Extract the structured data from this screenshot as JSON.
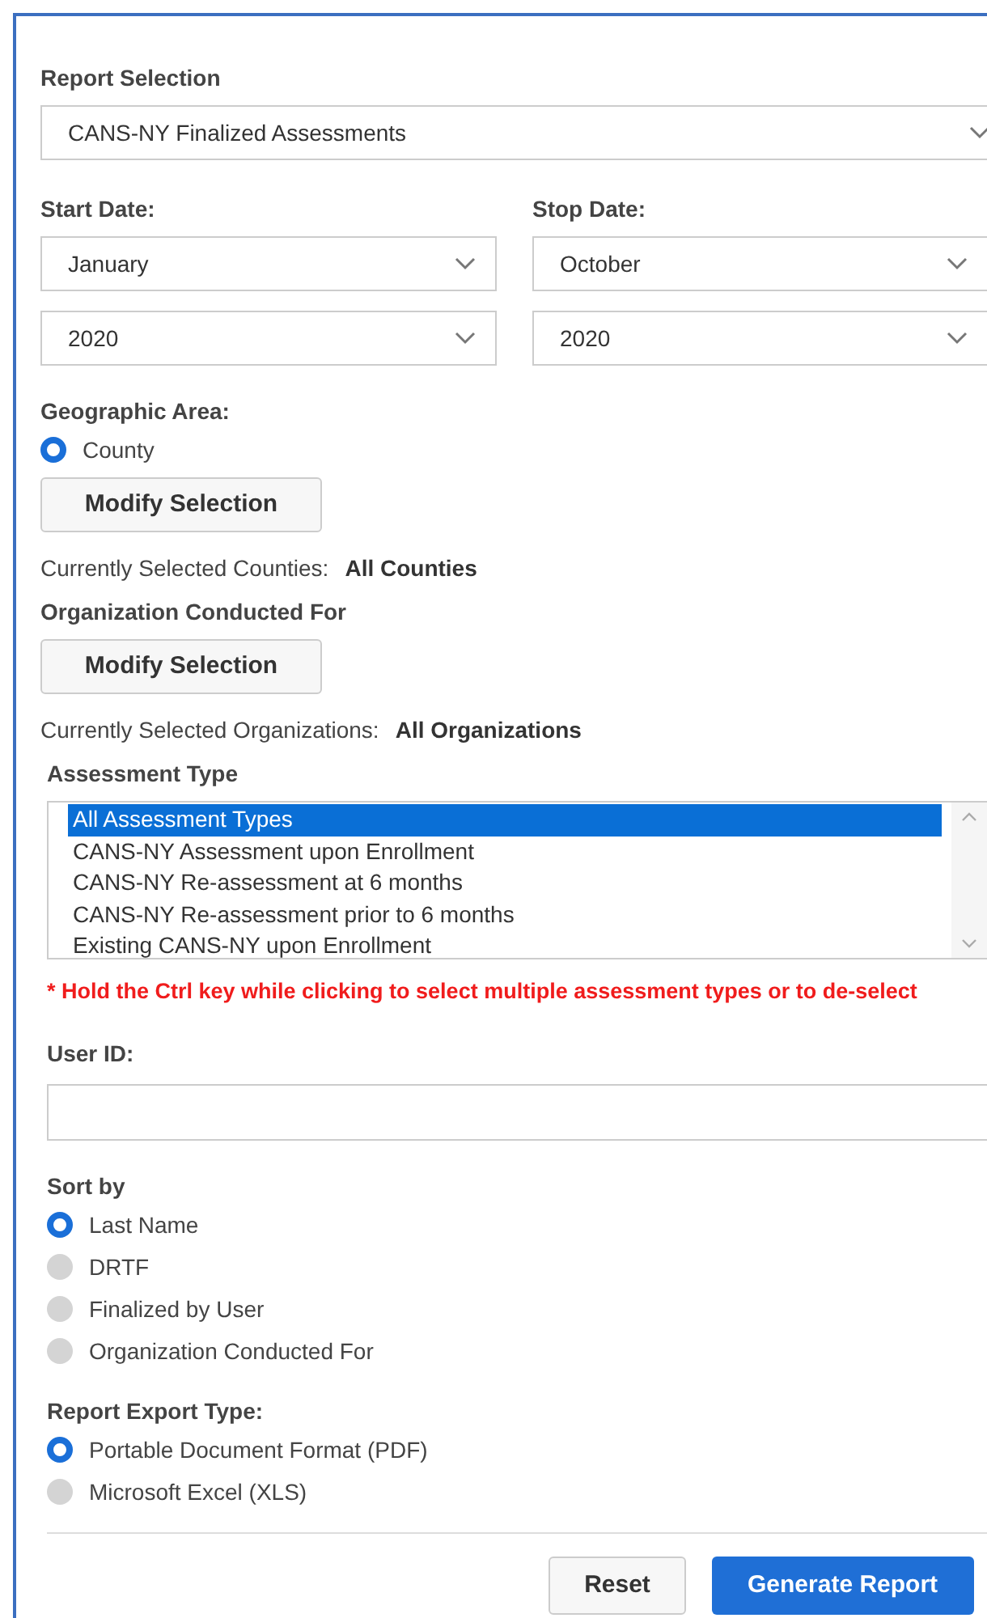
{
  "report_selection": {
    "label": "Report Selection",
    "value": "CANS-NY Finalized Assessments"
  },
  "start_date": {
    "label": "Start Date:",
    "month": "January",
    "year": "2020"
  },
  "stop_date": {
    "label": "Stop Date:",
    "month": "October",
    "year": "2020"
  },
  "geographic_area": {
    "label": "Geographic Area:",
    "options": [
      {
        "label": "County",
        "selected": true
      }
    ]
  },
  "county_button": "Modify Selection",
  "counties": {
    "label": "Currently Selected Counties:",
    "value": "All Counties"
  },
  "organization": {
    "label": "Organization Conducted For",
    "button": "Modify Selection"
  },
  "organizations": {
    "label": "Currently Selected Organizations:",
    "value": "All Organizations"
  },
  "assessment_type": {
    "label": "Assessment Type",
    "items": [
      {
        "label": "All Assessment Types",
        "selected": true
      },
      {
        "label": "CANS-NY Assessment upon Enrollment",
        "selected": false
      },
      {
        "label": "CANS-NY Re-assessment at 6 months",
        "selected": false
      },
      {
        "label": "CANS-NY Re-assessment prior to 6 months",
        "selected": false
      },
      {
        "label": "Existing CANS-NY upon Enrollment",
        "selected": false
      }
    ]
  },
  "hint": "* Hold the Ctrl key while clicking to select multiple assessment types or to de-select",
  "user_id": {
    "label": "User ID:"
  },
  "sort_by": {
    "label": "Sort by",
    "options": [
      {
        "label": "Last Name",
        "selected": true
      },
      {
        "label": "DRTF",
        "selected": false
      },
      {
        "label": "Finalized by User",
        "selected": false
      },
      {
        "label": "Organization Conducted For",
        "selected": false
      }
    ]
  },
  "export_type": {
    "label": "Report Export Type:",
    "options": [
      {
        "label": "Portable Document Format (PDF)",
        "selected": true
      },
      {
        "label": "Microsoft Excel (XLS)",
        "selected": false
      }
    ]
  },
  "buttons": [
    "Reset",
    "Generate Report"
  ]
}
